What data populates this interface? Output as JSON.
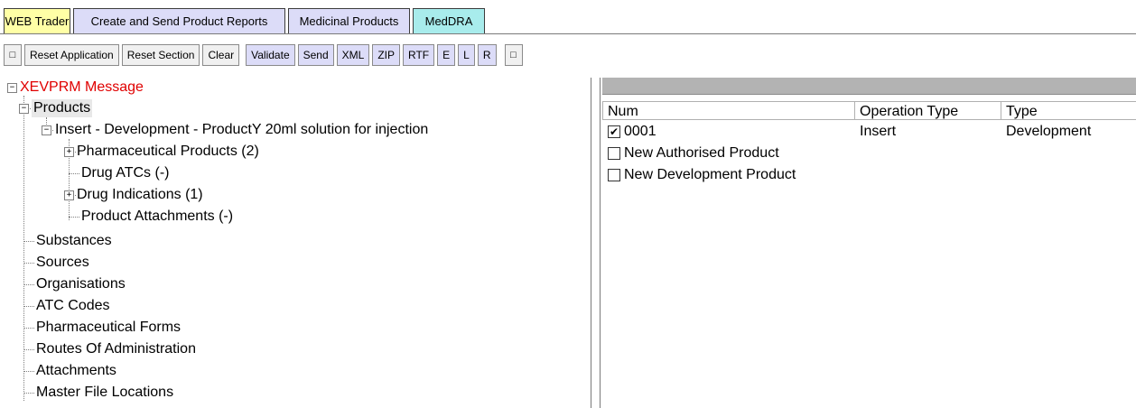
{
  "tabs": [
    {
      "label": "WEB Trader",
      "color": "#ffffa6"
    },
    {
      "label": "Create and Send Product Reports",
      "color": "#dcdcf8"
    },
    {
      "label": "Medicinal Products",
      "color": "#dcdcf8"
    },
    {
      "label": "MedDRA",
      "color": "#a8ecec"
    }
  ],
  "toolbar": {
    "square_icon": "□",
    "reset_application": "Reset Application",
    "reset_section": "Reset Section",
    "clear": "Clear",
    "validate": "Validate",
    "send": "Send",
    "xml": "XML",
    "zip": "ZIP",
    "rtf": "RTF",
    "e": "E",
    "l": "L",
    "r": "R",
    "square_icon_2": "□"
  },
  "tree": {
    "root": "XEVPRM Message",
    "products": "Products",
    "insert_item": "Insert - Development - ProductY 20ml solution for injection",
    "pharma_products": "Pharmaceutical Products (2)",
    "drug_atcs": "Drug ATCs (-)",
    "drug_indications": "Drug Indications (1)",
    "product_attachments": "Product Attachments (-)",
    "substances": "Substances",
    "sources": "Sources",
    "organisations": "Organisations",
    "atc_codes": "ATC Codes",
    "pharma_forms": "Pharmaceutical Forms",
    "routes": "Routes Of Administration",
    "attachments": "Attachments",
    "master_file": "Master File Locations",
    "expand_glyph": "+",
    "collapse_glyph": "−"
  },
  "table": {
    "headers": [
      "Num",
      "Operation Type",
      "Type"
    ],
    "rows": [
      {
        "num": "0001",
        "operation": "Insert",
        "type": "Development",
        "checked": true
      },
      {
        "num": "New Authorised Product",
        "operation": "",
        "type": "",
        "checked": false
      },
      {
        "num": "New Development Product",
        "operation": "",
        "type": "",
        "checked": false
      }
    ],
    "check_glyph": "✔"
  }
}
